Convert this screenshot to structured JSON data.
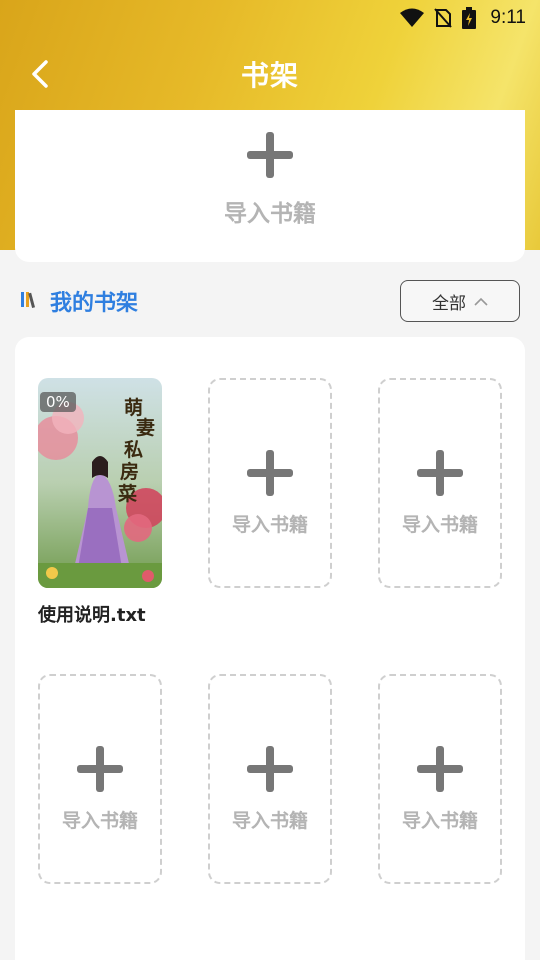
{
  "status": {
    "time": "9:11"
  },
  "header": {
    "title": "书架"
  },
  "import_card": {
    "label": "导入书籍"
  },
  "shelf": {
    "title": "我的书架",
    "filter_label": "全部"
  },
  "books": [
    {
      "name": "使用说明.txt",
      "progress": "0%",
      "cover_title": "萌妻私房菜"
    }
  ],
  "empty_slot_label": "导入书籍",
  "colors": {
    "accent": "#2f7fe0",
    "header_gold": "#e6b928",
    "placeholder_gray": "#b4b4b4"
  }
}
